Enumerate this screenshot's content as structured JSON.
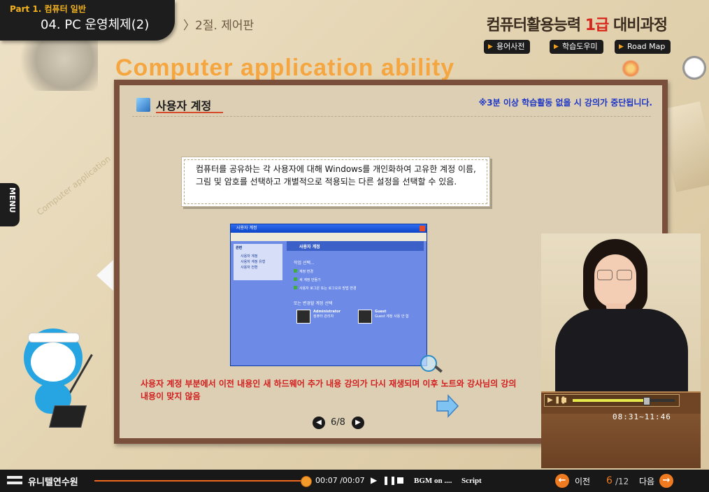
{
  "header": {
    "part": "Part 1. 컴퓨터 일반",
    "chapter": "04. PC 운영체제(2)",
    "section": "〉2절. 제어판",
    "course_title_pre": "컴퓨터활용능력",
    "course_title_red": "1급",
    "course_title_post": "대비과정",
    "buttons": [
      "용어사전",
      "학습도우미",
      "Road Map"
    ],
    "background_title": "Computer application ability"
  },
  "side": {
    "menu_label": "MENU",
    "watermark": "Computer application"
  },
  "board": {
    "title": "사용자 계정",
    "notice": "※3분 이상 학습활동 없을 시 강의가 중단됩니다.",
    "definition": "컴퓨터를 공유하는 각 사용자에 대해 Windows를 개인화하여 고유한 계정 이름, 그림 및 암호를 선택하고 개별적으로 적용되는 다른 설정을 선택할 수 있음.",
    "note": "사용자 계정 부분에서 이전 내용인 새 하드웨어 추가 내용 강의가 다시 재생되며 이후 노트와 강사님의 강의 내용이 맞지 않음",
    "page_counter": "6/8"
  },
  "xp_window": {
    "title": "사용자 계정",
    "side_items": [
      "관련",
      "사용자 계정",
      "사용자 계정 유형",
      "사용자 전환"
    ],
    "header": "사용자 계정",
    "task_label": "작업 선택...",
    "tasks": [
      "계정 변경",
      "새 계정 만들기",
      "사용자 로그온 또는 로그오프 방법 변경"
    ],
    "change_label": "또는 변경할 계정 선택",
    "accounts": [
      {
        "name": "Administrator",
        "sub": "컴퓨터 관리자"
      },
      {
        "name": "Guest",
        "sub": "Guest 계정 사용 안 함"
      }
    ]
  },
  "video": {
    "time": "08:31~11:46",
    "progress": 0.72
  },
  "footer": {
    "logo": "유니텔연수원",
    "time": "00:07 /00:07",
    "progress": 1.0,
    "bgm": "BGM on ....",
    "script": "Script",
    "prev": "이전",
    "next": "다음",
    "page_current": "6",
    "page_total": "/12"
  },
  "colors": {
    "accent": "#ef7a1f",
    "notice_blue": "#1c35c7",
    "note_red": "#d21e1e",
    "board_frame": "#7a4f3b"
  }
}
